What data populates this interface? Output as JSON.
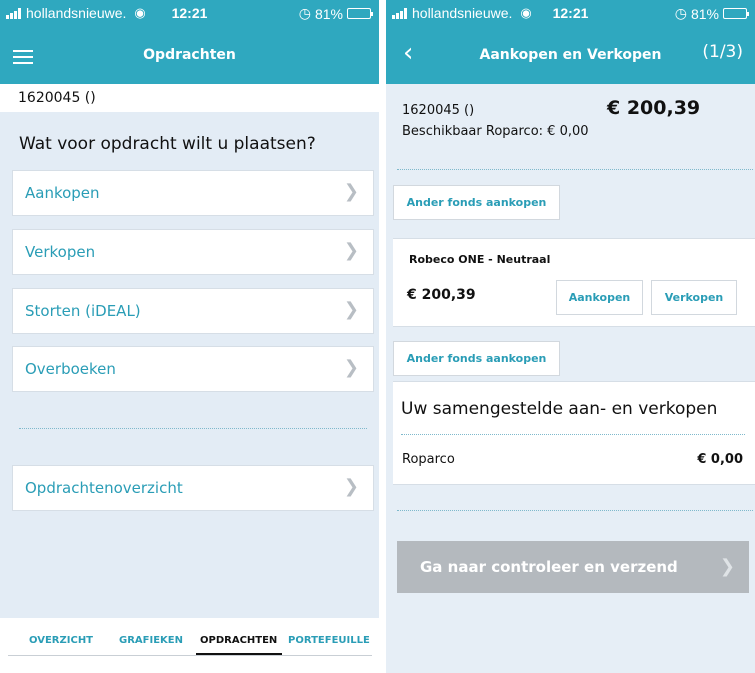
{
  "left": {
    "status": {
      "carrier": "hollandsnieuwe.",
      "time": "12:21",
      "battery": "81%",
      "battery_level": 0.81
    },
    "nav": {
      "title": "Opdrachten"
    },
    "account": "1620045 ()",
    "question": "Wat voor opdracht wilt u plaatsen?",
    "menu": [
      {
        "label": "Aankopen"
      },
      {
        "label": "Verkopen"
      },
      {
        "label": "Storten (iDEAL)"
      },
      {
        "label": "Overboeken"
      }
    ],
    "overview": {
      "label": "Opdrachtenoverzicht"
    },
    "tabs": [
      {
        "label": "OVERZICHT"
      },
      {
        "label": "GRAFIEKEN"
      },
      {
        "label": "OPDRACHTEN",
        "active": true
      },
      {
        "label": "PORTEFEUILLE"
      }
    ]
  },
  "right": {
    "status": {
      "carrier": "hollandsnieuwe.",
      "time": "12:21",
      "battery": "81%",
      "battery_level": 0.81
    },
    "nav": {
      "title": "Aankopen en Verkopen",
      "step": "(1/3)"
    },
    "account": "1620045 ()",
    "amount": "€ 200,39",
    "available": "Beschikbaar Roparco: € 0,00",
    "other_fund_button": "Ander fonds aankopen",
    "fund": {
      "name": "Robeco ONE - Neutraal",
      "value": "€ 200,39",
      "buy": "Aankopen",
      "sell": "Verkopen"
    },
    "summary": {
      "title": "Uw samengestelde aan- en verkopen",
      "row_label": "Roparco",
      "row_value": "€ 0,00"
    },
    "submit": "Ga naar controleer en verzend"
  },
  "colors": {
    "header": "#2fa8bf",
    "accent": "#2a9db6",
    "background": "#e3ecf5",
    "disabled_button": "#b4b9be"
  },
  "icons": [
    "signal-icon",
    "wifi-icon",
    "alarm-icon",
    "battery-icon",
    "menu-icon",
    "back-icon",
    "chevron-right-icon"
  ]
}
